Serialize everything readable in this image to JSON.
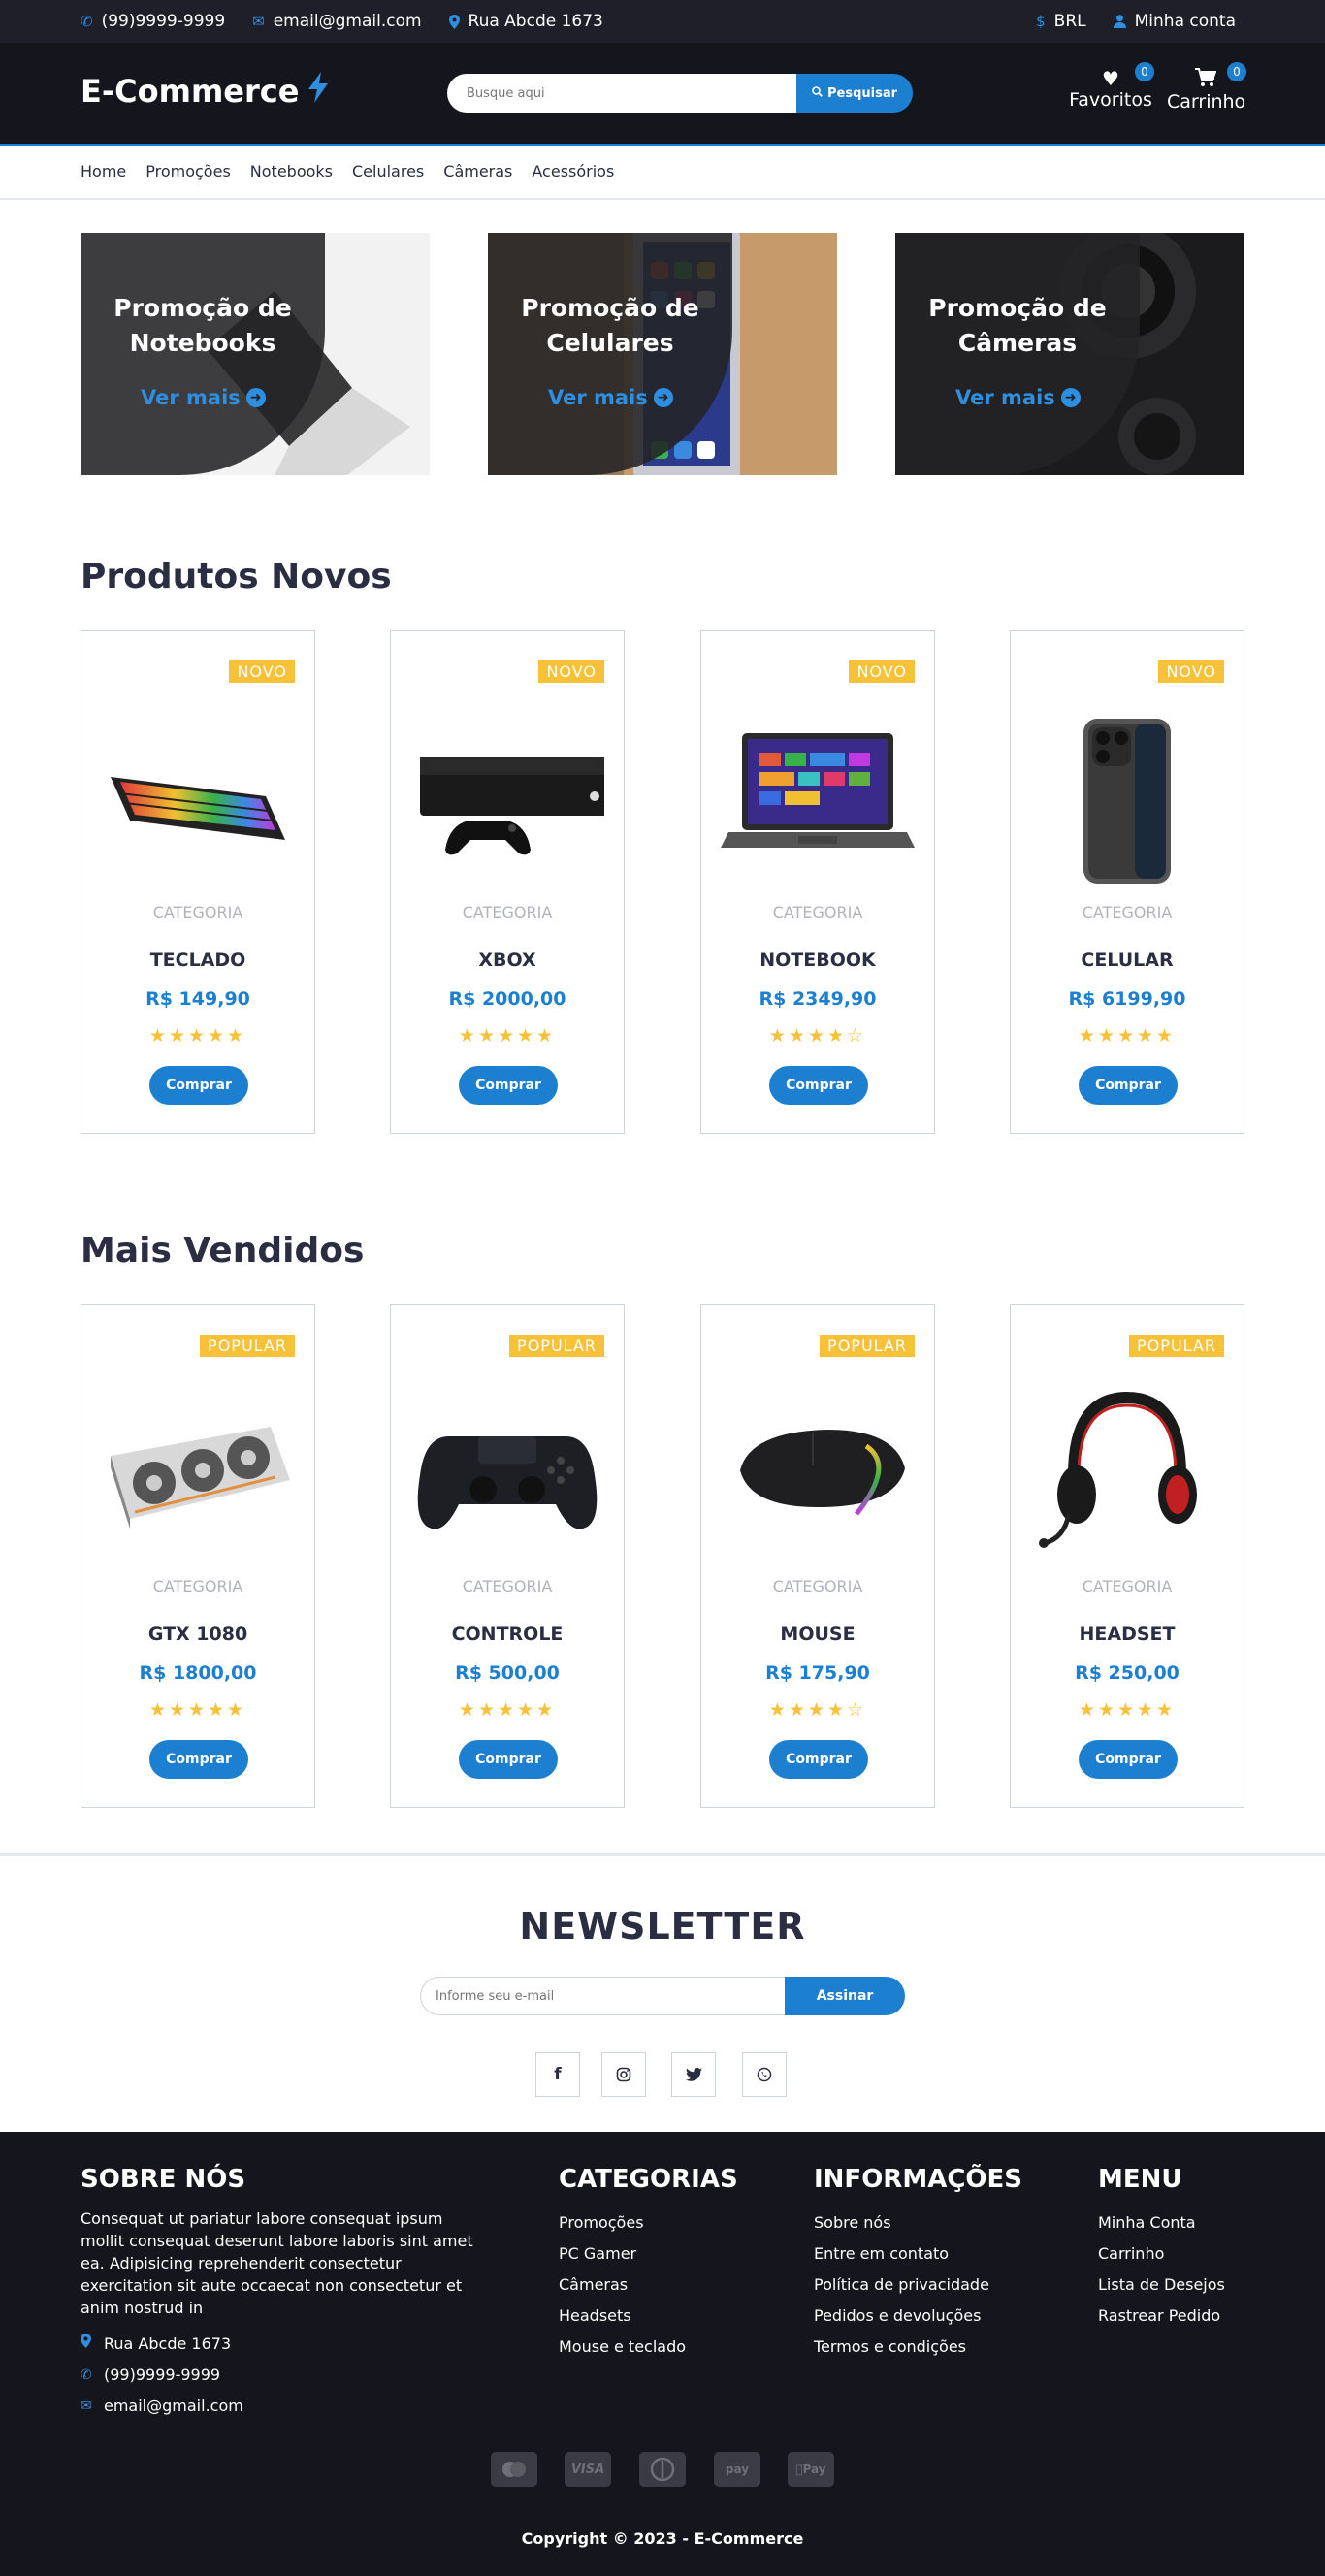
{
  "topbar": {
    "phone": "(99)9999-9999",
    "email": "email@gmail.com",
    "address": "Rua Abcde 1673",
    "currency": "BRL",
    "account": "Minha conta"
  },
  "header": {
    "logo": "E-Commerce",
    "search_placeholder": "Busque aqui",
    "search_button": "Pesquisar",
    "favorites_label": "Favoritos",
    "favorites_count": "0",
    "cart_label": "Carrinho",
    "cart_count": "0"
  },
  "nav": [
    "Home",
    "Promoções",
    "Notebooks",
    "Celulares",
    "Câmeras",
    "Acessórios"
  ],
  "promos": [
    {
      "title_line1": "Promoção de",
      "title_line2": "Notebooks",
      "link": "Ver mais"
    },
    {
      "title_line1": "Promoção de",
      "title_line2": "Celulares",
      "link": "Ver mais"
    },
    {
      "title_line1": "Promoção de",
      "title_line2": "Câmeras",
      "link": "Ver mais"
    }
  ],
  "new_products": {
    "title": "Produtos Novos",
    "items": [
      {
        "badge": "NOVO",
        "category": "CATEGORIA",
        "name": "TECLADO",
        "price": "R$ 149,90",
        "rating": 5,
        "button": "Comprar",
        "image": "keyboard"
      },
      {
        "badge": "NOVO",
        "category": "CATEGORIA",
        "name": "XBOX",
        "price": "R$ 2000,00",
        "rating": 5,
        "button": "Comprar",
        "image": "console"
      },
      {
        "badge": "NOVO",
        "category": "CATEGORIA",
        "name": "NOTEBOOK",
        "price": "R$ 2349,90",
        "rating": 4,
        "button": "Comprar",
        "image": "laptop"
      },
      {
        "badge": "NOVO",
        "category": "CATEGORIA",
        "name": "CELULAR",
        "price": "R$ 6199,90",
        "rating": 5,
        "button": "Comprar",
        "image": "phone"
      }
    ]
  },
  "best_sellers": {
    "title": "Mais Vendidos",
    "items": [
      {
        "badge": "POPULAR",
        "category": "CATEGORIA",
        "name": "GTX 1080",
        "price": "R$ 1800,00",
        "rating": 5,
        "button": "Comprar",
        "image": "gpu"
      },
      {
        "badge": "POPULAR",
        "category": "CATEGORIA",
        "name": "CONTROLE",
        "price": "R$ 500,00",
        "rating": 5,
        "button": "Comprar",
        "image": "controller"
      },
      {
        "badge": "POPULAR",
        "category": "CATEGORIA",
        "name": "MOUSE",
        "price": "R$ 175,90",
        "rating": 4,
        "button": "Comprar",
        "image": "mouse"
      },
      {
        "badge": "POPULAR",
        "category": "CATEGORIA",
        "name": "HEADSET",
        "price": "R$ 250,00",
        "rating": 5,
        "button": "Comprar",
        "image": "headset"
      }
    ]
  },
  "newsletter": {
    "title": "NEWSLETTER",
    "placeholder": "Informe seu e-mail",
    "button": "Assinar"
  },
  "footer": {
    "about_title": "SOBRE NÓS",
    "about_text": "Consequat ut pariatur labore consequat ipsum mollit consequat deserunt labore laboris sint amet ea. Adipisicing reprehenderit consectetur exercitation sit aute occaecat non consectetur et anim nostrud in",
    "address": "Rua Abcde 1673",
    "phone": "(99)9999-9999",
    "email": "email@gmail.com",
    "categories_title": "CATEGORIAS",
    "categories": [
      "Promoções",
      "PC Gamer",
      "Câmeras",
      "Headsets",
      "Mouse e teclado"
    ],
    "info_title": "INFORMAÇÕES",
    "info": [
      "Sobre nós",
      "Entre em contato",
      "Política de privacidade",
      "Pedidos e devoluções",
      "Termos e condições"
    ],
    "menu_title": "MENU",
    "menu": [
      "Minha Conta",
      "Carrinho",
      "Lista de Desejos",
      "Rastrear Pedido"
    ],
    "copyright": "Copyright © 2023 - E-Commerce",
    "payment_icons": [
      "mastercard-icon",
      "visa-icon",
      "diners-icon",
      "amazon-pay-icon",
      "apple-pay-icon"
    ]
  },
  "colors": {
    "accent": "#1d7fd0",
    "dark": "#15161d",
    "badge": "#f8c13a"
  }
}
